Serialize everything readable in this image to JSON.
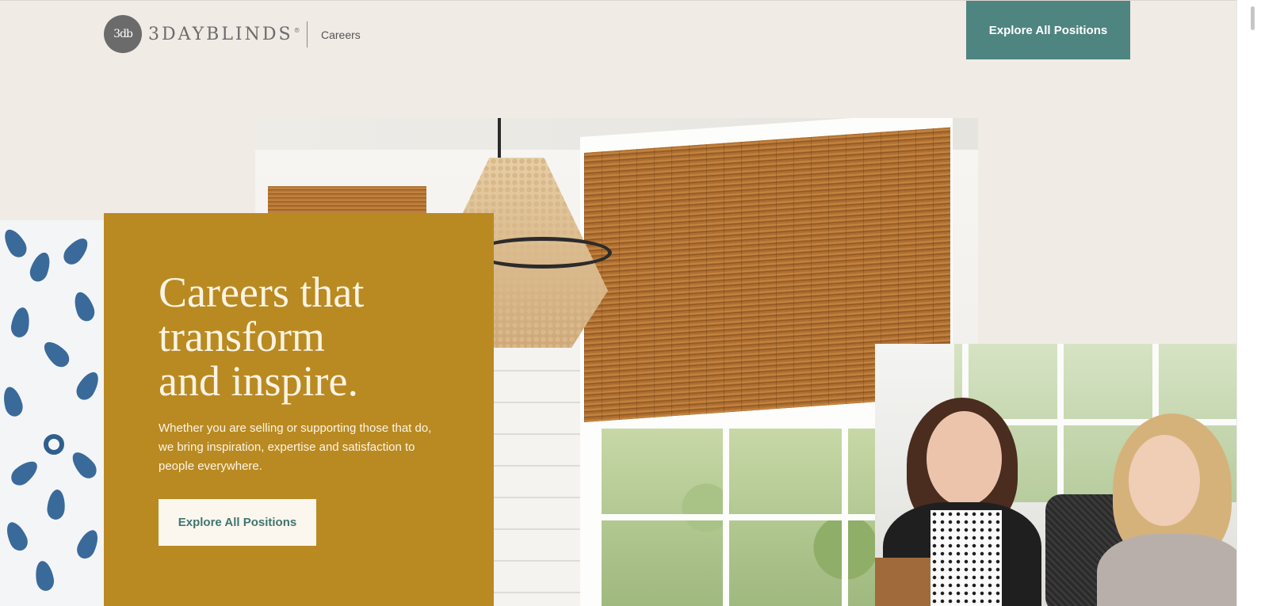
{
  "header": {
    "logo_mark": "3db",
    "logo_word": "3DAYBLINDS",
    "logo_reg": "®",
    "careers_label": "Careers",
    "cta_label": "Explore All Positions"
  },
  "hero": {
    "title_lines": [
      "Careers that",
      "transform",
      "and inspire."
    ],
    "description": "Whether you are selling or supporting those that do, we bring inspiration, expertise and satisfaction to people everywhere.",
    "cta_label": "Explore All Positions"
  },
  "colors": {
    "background": "#f0ebe5",
    "accent_teal": "#4f8580",
    "hero_gold": "#b98a22",
    "hero_text": "#fbf4e4"
  },
  "images": {
    "main": "window-bamboo-shade-chandelier-image",
    "pattern": "blue-floral-pattern-image",
    "people": "two-women-smiling-image"
  }
}
